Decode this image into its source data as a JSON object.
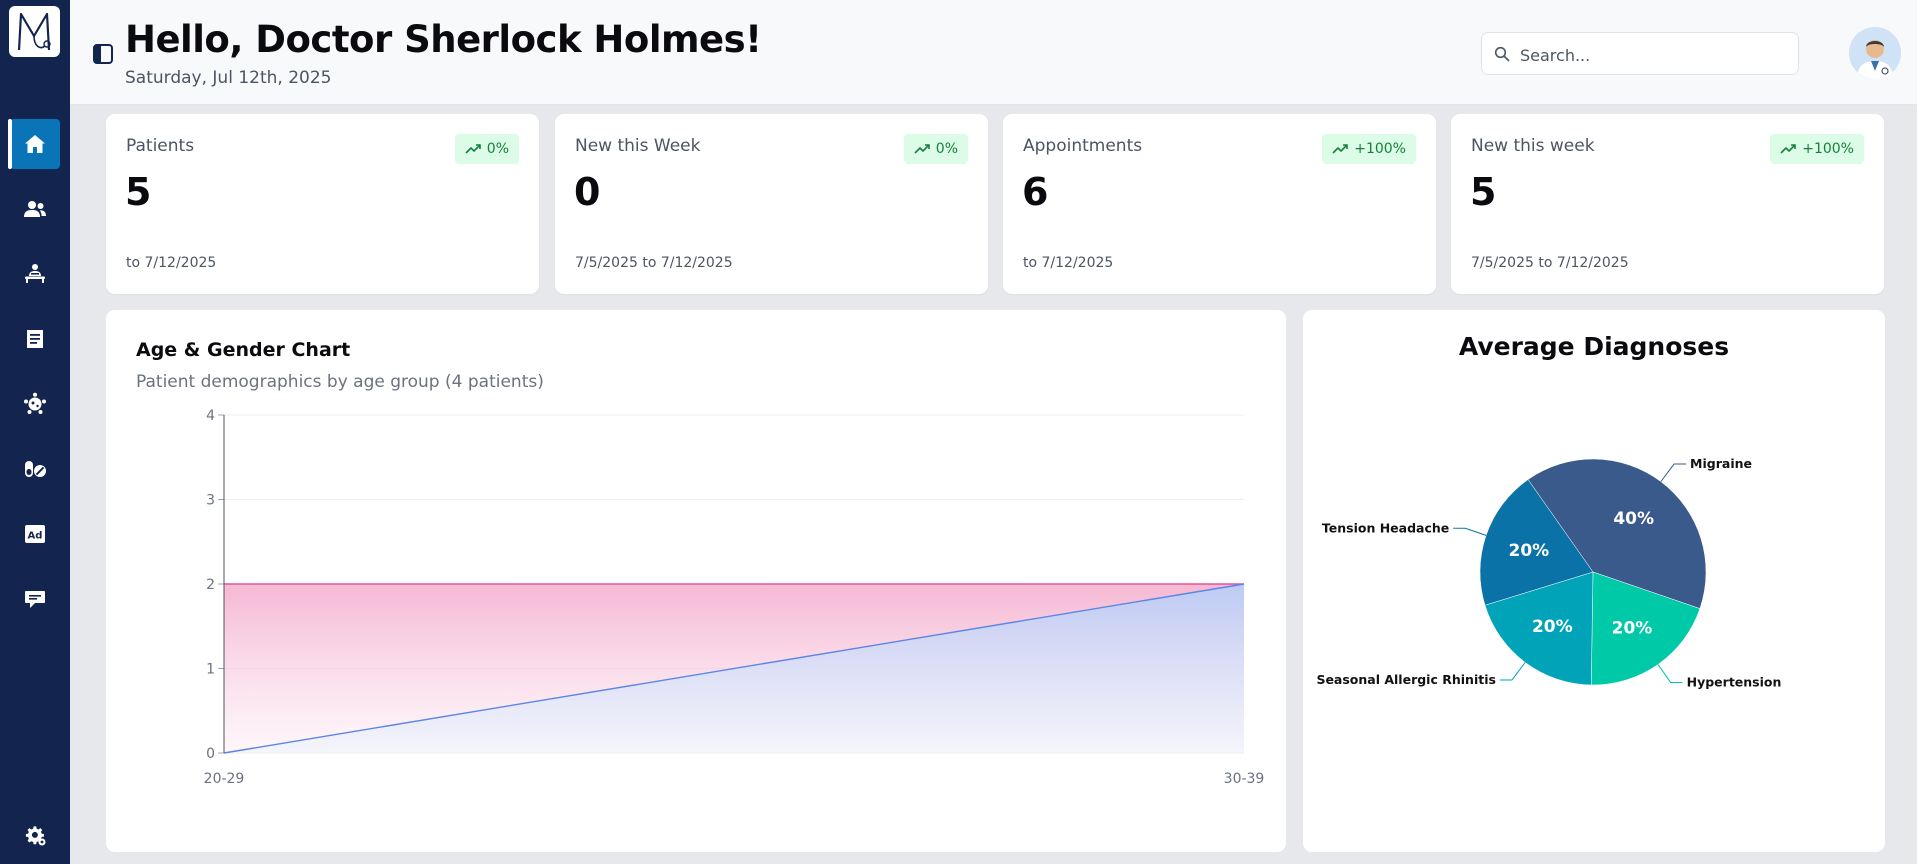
{
  "header": {
    "greeting": "Hello, Doctor Sherlock Holmes!",
    "date": "Saturday, Jul 12th, 2025",
    "search_placeholder": "Search..."
  },
  "sidebar": {
    "items": [
      {
        "icon": "home-icon",
        "active": true
      },
      {
        "icon": "users-icon",
        "active": false
      },
      {
        "icon": "patient-bed-icon",
        "active": false
      },
      {
        "icon": "document-icon",
        "active": false
      },
      {
        "icon": "virus-icon",
        "active": false
      },
      {
        "icon": "pills-icon",
        "active": false
      },
      {
        "icon": "ad-icon",
        "active": false
      },
      {
        "icon": "chat-icon",
        "active": false
      }
    ],
    "settings_icon": "gear-icon"
  },
  "stats": [
    {
      "title": "Patients",
      "value": "5",
      "badge": "0%",
      "range": "to 7/12/2025"
    },
    {
      "title": "New this Week",
      "value": "0",
      "badge": "0%",
      "range": "7/5/2025 to 7/12/2025"
    },
    {
      "title": "Appointments",
      "value": "6",
      "badge": "+100%",
      "range": "to 7/12/2025"
    },
    {
      "title": "New this week",
      "value": "5",
      "badge": "+100%",
      "range": "7/5/2025 to 7/12/2025"
    }
  ],
  "colors": {
    "sidebar": "#13254f",
    "accent": "#0a74b9",
    "badge_bg": "#dcfce7",
    "badge_text": "#15803d",
    "female_line": "#e0559a",
    "male_line": "#5b86e5"
  },
  "chart_data": [
    {
      "type": "area",
      "title": "Age & Gender Chart",
      "subtitle": "Patient demographics by age group (4 patients)",
      "categories": [
        "20-29",
        "30-39"
      ],
      "series": [
        {
          "values": [
            2,
            2
          ],
          "color": "#e0559a"
        },
        {
          "values": [
            0,
            2
          ],
          "color": "#5b86e5"
        }
      ],
      "ylim": [
        0,
        4
      ],
      "yticks": [
        0,
        1,
        2,
        3,
        4
      ],
      "grid": true
    },
    {
      "type": "pie",
      "title": "Average Diagnoses",
      "slices": [
        {
          "label": "Migraine",
          "value": 40,
          "display": "40%",
          "color": "#3a5a8c"
        },
        {
          "label": "Hypertension",
          "value": 20,
          "display": "20%",
          "color": "#00c9a7"
        },
        {
          "label": "Seasonal Allergic Rhinitis",
          "value": 20,
          "display": "20%",
          "color": "#00a3b8"
        },
        {
          "label": "Tension Headache",
          "value": 20,
          "display": "20%",
          "color": "#0b72a8"
        }
      ]
    }
  ]
}
